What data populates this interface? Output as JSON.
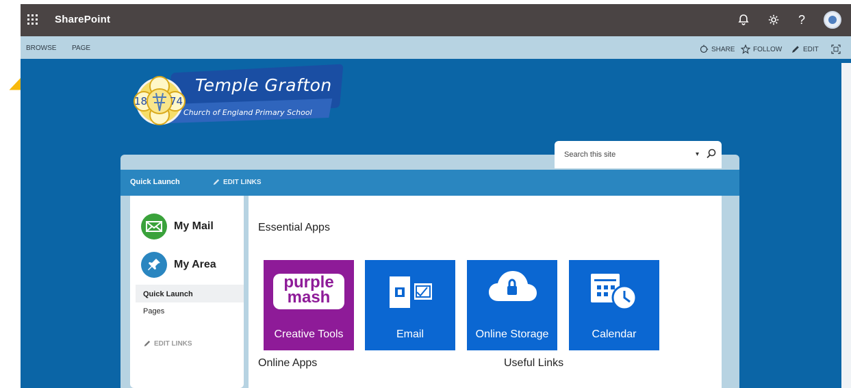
{
  "suite": {
    "title": "SharePoint",
    "icons": [
      "notification-bell-icon",
      "settings-gear-icon",
      "help-icon",
      "user-avatar"
    ]
  },
  "ribbon": {
    "browse_label": "BROWSE",
    "page_label": "PAGE",
    "share_label": "SHARE",
    "follow_label": "FOLLOW",
    "edit_label": "EDIT"
  },
  "site": {
    "name": "Temple Grafton",
    "subtitle": "Church of England Primary School",
    "logo_year_left": "18",
    "logo_year_right": "74"
  },
  "search": {
    "placeholder": "Search this site"
  },
  "quick_launch": {
    "title": "Quick Launch",
    "edit_links_label": "EDIT LINKS"
  },
  "left_nav": {
    "big_items": [
      {
        "label": "My Mail",
        "icon": "envelope-icon",
        "color": "#3aa23b"
      },
      {
        "label": "My Area",
        "icon": "pin-icon",
        "color": "#2a86c0"
      }
    ],
    "items": [
      {
        "label": "Quick Launch"
      },
      {
        "label": "Pages"
      }
    ],
    "edit_links_label": "EDIT LINKS"
  },
  "main": {
    "essential_title": "Essential Apps",
    "online_title": "Online Apps",
    "useful_title": "Useful Links",
    "tiles": [
      {
        "label": "Creative Tools",
        "brand_top": "purple",
        "brand_bottom": "mash",
        "color": "#8e1b98"
      },
      {
        "label": "Email",
        "color": "#0b67d2"
      },
      {
        "label": "Online Storage",
        "color": "#0b67d2"
      },
      {
        "label": "Calendar",
        "color": "#0b67d2"
      }
    ]
  },
  "colors": {
    "suite_bar": "#4a4444",
    "ribbon": "#b7d3e2",
    "background": "#0b65a6",
    "quick_launch_bar": "#2a86c0",
    "arrow": "#f7b90d"
  }
}
